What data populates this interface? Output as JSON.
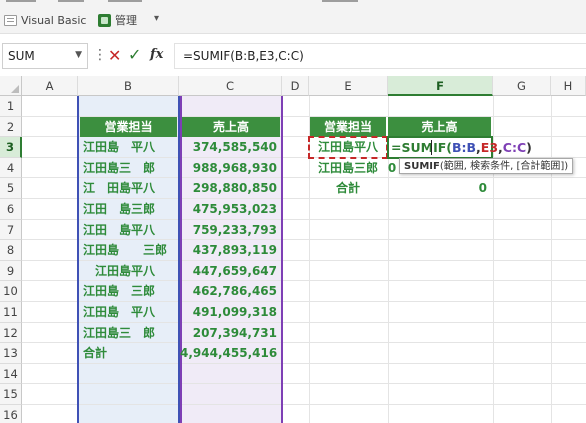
{
  "ribbon": {
    "vb_label": "Visual Basic",
    "manage_label": "管理"
  },
  "formula_bar": {
    "name_box": "SUM",
    "formula": "=SUMIF(B:B,E3,C:C)"
  },
  "columns": [
    "A",
    "B",
    "C",
    "D",
    "E",
    "F",
    "G",
    "H"
  ],
  "rows": [
    "1",
    "2",
    "3",
    "4",
    "5",
    "6",
    "7",
    "8",
    "9",
    "10",
    "11",
    "12",
    "13",
    "14",
    "15",
    "16"
  ],
  "table": {
    "header_name": "営業担当",
    "header_sales": "売上高",
    "names": [
      "江田島　平八",
      "江田島三　郎",
      "江　田島平八",
      "江田　島三郎",
      "江田　島平八",
      "江田島　　三郎",
      "　江田島平八",
      "江田島　三郎",
      "江田島　平八",
      "江田島三　郎"
    ],
    "sales": [
      "374,585,540",
      "988,968,930",
      "298,880,850",
      "475,953,023",
      "759,233,793",
      "437,893,119",
      "447,659,647",
      "462,786,465",
      "491,099,318",
      "207,394,731"
    ],
    "total_label": "合計",
    "total_value": "4,944,455,416"
  },
  "summary": {
    "header_name": "営業担当",
    "header_sales": "売上高",
    "name1": "江田島平八",
    "name2": "江田島三郎",
    "value2": "0",
    "total_label": "合計",
    "total_value": "0"
  },
  "editing": {
    "part_eq": "=SUM",
    "part_if": "IF(",
    "part_bb": "B:B",
    "comma1": ",",
    "part_e3": "E3",
    "comma2": ",",
    "part_cc": "C:C",
    "close": ")",
    "tooltip_fn": "SUMIF",
    "tooltip_args": "(範囲, 検索条件, [合計範囲])"
  },
  "colors": {
    "accent_green": "#2e7d32",
    "header_green": "#3c8f3f",
    "range_blue": "#3f51b5",
    "range_purple": "#7e3fb5",
    "criteria_red": "#c62828"
  }
}
